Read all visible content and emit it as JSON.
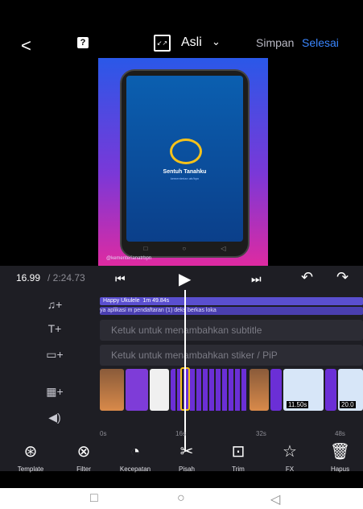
{
  "header": {
    "back_icon": "back-icon",
    "help_label": "?",
    "ratio_label": "Asli",
    "save_label": "Simpan",
    "done_label": "Selesai"
  },
  "preview": {
    "app_name": "Sentuh Tanahku",
    "app_sub": "kementerian atr/bpn",
    "social_text": "@kementerianatrbpn"
  },
  "player": {
    "current_time": "16.99",
    "total_time": "/ 2:24.73"
  },
  "tracks": {
    "music_title": "Happy Ukulele",
    "music_duration": "1m 49.84s",
    "music_lyrics": "ya    aplikasi m    pendaftaran (1)          deks berkas     loka",
    "subtitle_placeholder": "Ketuk untuk menambahkan subtitle",
    "sticker_placeholder": "Ketuk untuk menambahkan stiker / PiP",
    "clip_label_1": "11.50s",
    "clip_label_2": "20.0"
  },
  "ruler": [
    "0s",
    "16s",
    "32s",
    "48s"
  ],
  "toolbar": [
    {
      "label": "Template",
      "icon": "template-icon"
    },
    {
      "label": "Filter",
      "icon": "filter-icon"
    },
    {
      "label": "Kecepatan",
      "icon": "speed-icon"
    },
    {
      "label": "Pisah",
      "icon": "split-icon"
    },
    {
      "label": "Trim",
      "icon": "trim-icon"
    },
    {
      "label": "FX",
      "icon": "fx-icon"
    },
    {
      "label": "Hapus",
      "icon": "delete-icon"
    }
  ],
  "colors": {
    "accent": "#3a86ff",
    "highlight": "#f5c21b",
    "panel": "#1e1e24"
  }
}
